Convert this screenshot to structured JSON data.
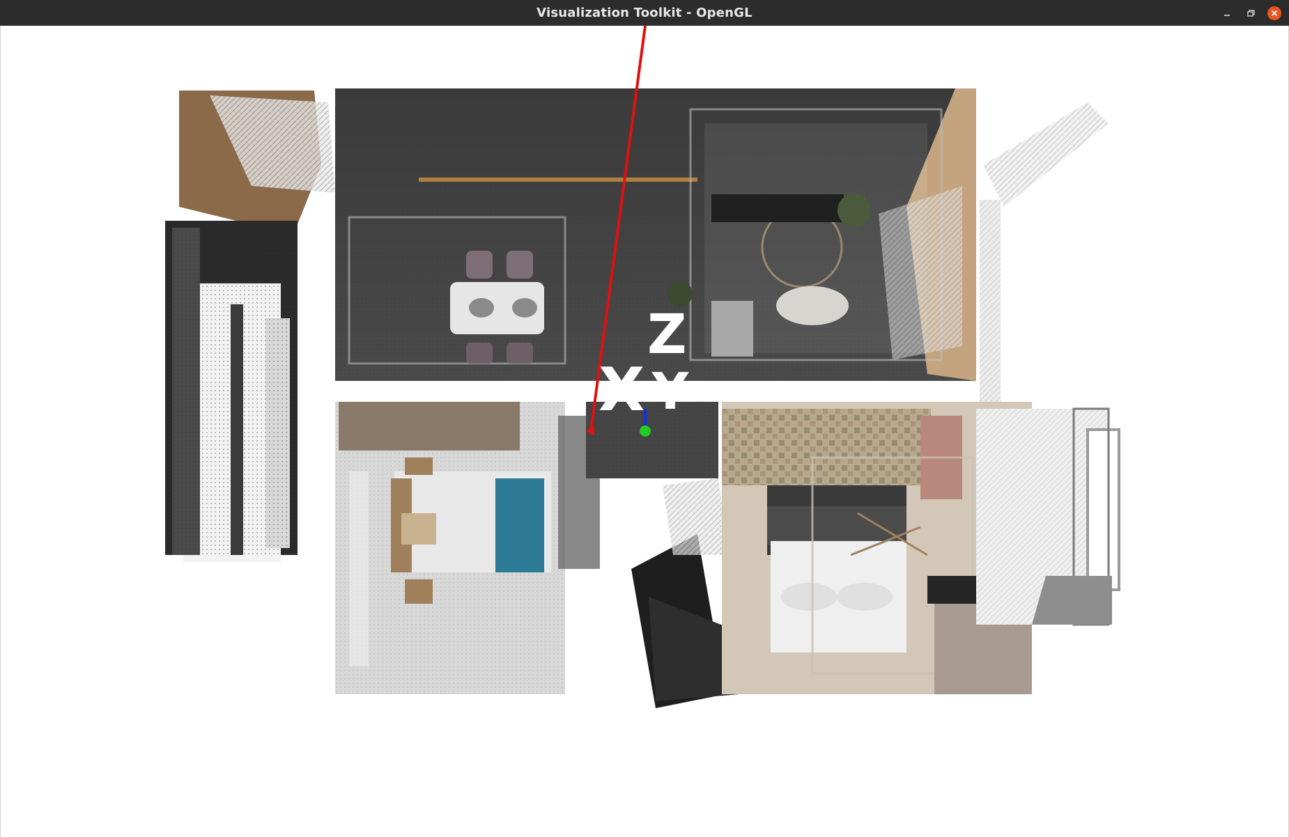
{
  "window": {
    "title": "Visualization Toolkit - OpenGL",
    "controls": [
      "minimize-icon",
      "restore-icon",
      "close-icon"
    ],
    "close_color": "#e95420"
  },
  "scene": {
    "background": "#ffffff",
    "description_icons": [
      "point-cloud",
      "axes-widget"
    ]
  },
  "axes": {
    "x_label": "X",
    "y_label": "Y",
    "z_label": "Z",
    "x_color": "#e01010",
    "y_color": "#22cc22",
    "z_color": "#1030e0"
  }
}
